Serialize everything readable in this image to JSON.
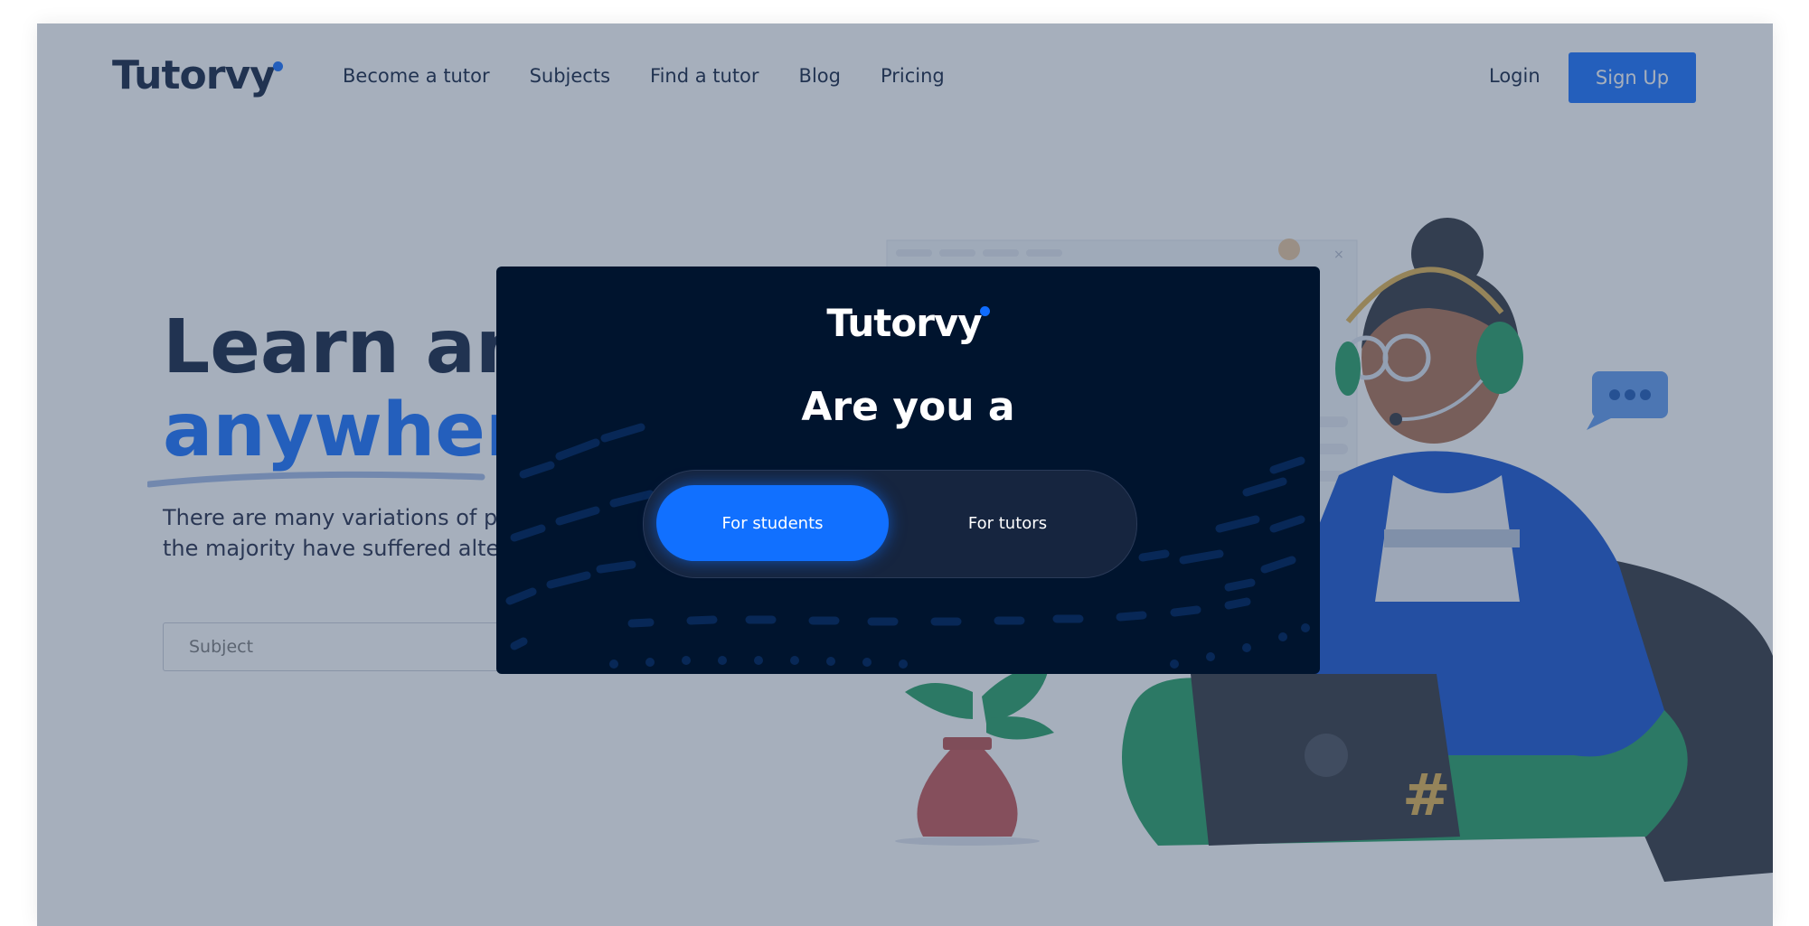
{
  "brand": {
    "name": "Tutorvy",
    "accent": "#0f6cff"
  },
  "nav": {
    "items": [
      "Become a tutor",
      "Subjects",
      "Find a tutor",
      "Blog",
      "Pricing"
    ],
    "login": "Login",
    "signup": "Sign Up"
  },
  "hero": {
    "headline_line1": "Learn any",
    "headline_line2": "anywher",
    "description_line1": "There are many variations of p",
    "description_line2": "the majority have suffered alte",
    "subject_placeholder": "Subject"
  },
  "modal": {
    "logo": "Tutorvy",
    "title": "Are you a",
    "options": [
      "For students",
      "For tutors"
    ],
    "selected": "For students"
  },
  "colors": {
    "dark": "#0b1a3a",
    "primary": "#0f6cff",
    "modal_bg": "#00142e",
    "overlay": "rgba(62,80,108,0.46)"
  },
  "icons": [
    "chat-bubble-icon",
    "close-icon",
    "hashtag-icon"
  ]
}
